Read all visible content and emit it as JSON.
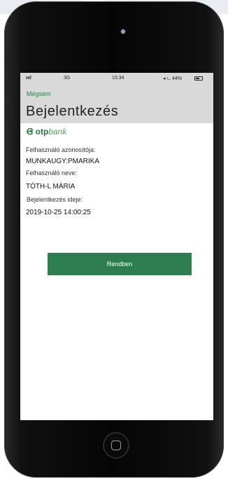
{
  "status_bar": {
    "signal": "ıııl",
    "network": "3G",
    "time": "15:34",
    "indicators": "◂ ⏾ 44%",
    "battery_icon": "battery-icon"
  },
  "nav": {
    "back_label": "Mégsem",
    "title": "Bejelentkezés"
  },
  "logo": {
    "brand_main": "otp",
    "brand_sub": "bank"
  },
  "details": {
    "user_id_label": "Felhasználó azonosítója:",
    "user_id_value": "MUNKAUGY:PMARIKA",
    "user_name_label": "Felhasználó neve:",
    "user_name_value": "TÓTH-L MÁRIA",
    "login_time_label": "Bejelentkezés ideje:",
    "login_time_value": "2019-10-25 14:00:25"
  },
  "actions": {
    "ok_label": "Rendben"
  },
  "colors": {
    "accent": "#2e7d4f",
    "nav_bg": "#d9d9d9",
    "logo_green": "#1f7a3a"
  }
}
